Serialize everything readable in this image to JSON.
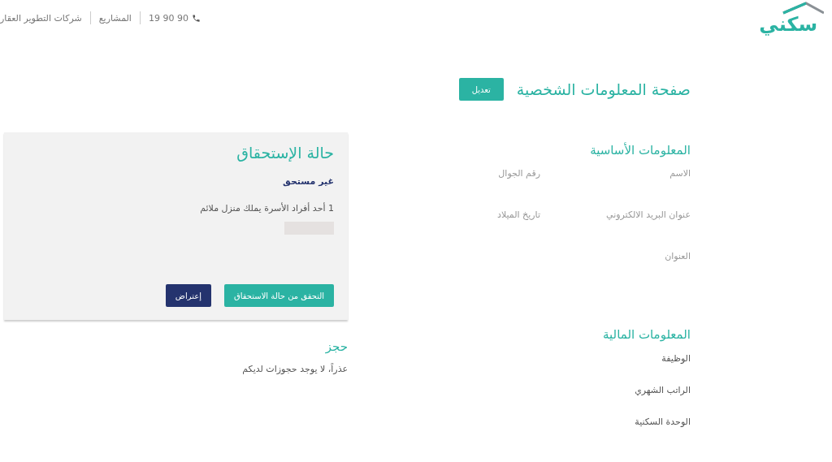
{
  "header": {
    "logo": "سكني",
    "phone": "19 90 90",
    "nav": [
      "المشاريع",
      "شركات التطوير العقار"
    ]
  },
  "page": {
    "title": "صفحة المعلومات الشخصية",
    "edit_button": "تعديل"
  },
  "basic_info": {
    "title": "المعلومات الأساسية",
    "fields": [
      "الاسم",
      "رقم الجوال",
      "عنوان البريد الالكتروني",
      "تاريخ الميلاد",
      "العنوان"
    ]
  },
  "financial_info": {
    "title": "المعلومات المالية",
    "fields": [
      "الوظيفة",
      "الراتب الشهري",
      "الوحدة السكنية"
    ]
  },
  "eligibility": {
    "title": "حالة الإستحقاق",
    "status": "غير مستحق",
    "reason": "1 أحد أفراد الأسرة يملك منزل ملائم",
    "buttons": [
      {
        "label": "التحقق من حالة الاستحقاق",
        "kind": "primary"
      },
      {
        "label": "إعتراض",
        "kind": "secondary"
      }
    ]
  },
  "booking": {
    "title": "حجز",
    "message": "عذراً، لا يوجد حجوزات لديكم"
  }
}
